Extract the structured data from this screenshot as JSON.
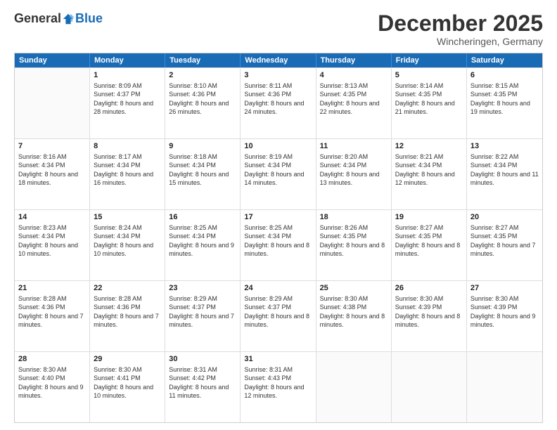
{
  "header": {
    "logo": {
      "general": "General",
      "blue": "Blue"
    },
    "title": "December 2025",
    "location": "Wincheringen, Germany"
  },
  "calendar": {
    "days_of_week": [
      "Sunday",
      "Monday",
      "Tuesday",
      "Wednesday",
      "Thursday",
      "Friday",
      "Saturday"
    ],
    "rows": [
      [
        {
          "day": "",
          "sunrise": "",
          "sunset": "",
          "daylight": ""
        },
        {
          "day": "1",
          "sunrise": "Sunrise: 8:09 AM",
          "sunset": "Sunset: 4:37 PM",
          "daylight": "Daylight: 8 hours and 28 minutes."
        },
        {
          "day": "2",
          "sunrise": "Sunrise: 8:10 AM",
          "sunset": "Sunset: 4:36 PM",
          "daylight": "Daylight: 8 hours and 26 minutes."
        },
        {
          "day": "3",
          "sunrise": "Sunrise: 8:11 AM",
          "sunset": "Sunset: 4:36 PM",
          "daylight": "Daylight: 8 hours and 24 minutes."
        },
        {
          "day": "4",
          "sunrise": "Sunrise: 8:13 AM",
          "sunset": "Sunset: 4:35 PM",
          "daylight": "Daylight: 8 hours and 22 minutes."
        },
        {
          "day": "5",
          "sunrise": "Sunrise: 8:14 AM",
          "sunset": "Sunset: 4:35 PM",
          "daylight": "Daylight: 8 hours and 21 minutes."
        },
        {
          "day": "6",
          "sunrise": "Sunrise: 8:15 AM",
          "sunset": "Sunset: 4:35 PM",
          "daylight": "Daylight: 8 hours and 19 minutes."
        }
      ],
      [
        {
          "day": "7",
          "sunrise": "Sunrise: 8:16 AM",
          "sunset": "Sunset: 4:34 PM",
          "daylight": "Daylight: 8 hours and 18 minutes."
        },
        {
          "day": "8",
          "sunrise": "Sunrise: 8:17 AM",
          "sunset": "Sunset: 4:34 PM",
          "daylight": "Daylight: 8 hours and 16 minutes."
        },
        {
          "day": "9",
          "sunrise": "Sunrise: 8:18 AM",
          "sunset": "Sunset: 4:34 PM",
          "daylight": "Daylight: 8 hours and 15 minutes."
        },
        {
          "day": "10",
          "sunrise": "Sunrise: 8:19 AM",
          "sunset": "Sunset: 4:34 PM",
          "daylight": "Daylight: 8 hours and 14 minutes."
        },
        {
          "day": "11",
          "sunrise": "Sunrise: 8:20 AM",
          "sunset": "Sunset: 4:34 PM",
          "daylight": "Daylight: 8 hours and 13 minutes."
        },
        {
          "day": "12",
          "sunrise": "Sunrise: 8:21 AM",
          "sunset": "Sunset: 4:34 PM",
          "daylight": "Daylight: 8 hours and 12 minutes."
        },
        {
          "day": "13",
          "sunrise": "Sunrise: 8:22 AM",
          "sunset": "Sunset: 4:34 PM",
          "daylight": "Daylight: 8 hours and 11 minutes."
        }
      ],
      [
        {
          "day": "14",
          "sunrise": "Sunrise: 8:23 AM",
          "sunset": "Sunset: 4:34 PM",
          "daylight": "Daylight: 8 hours and 10 minutes."
        },
        {
          "day": "15",
          "sunrise": "Sunrise: 8:24 AM",
          "sunset": "Sunset: 4:34 PM",
          "daylight": "Daylight: 8 hours and 10 minutes."
        },
        {
          "day": "16",
          "sunrise": "Sunrise: 8:25 AM",
          "sunset": "Sunset: 4:34 PM",
          "daylight": "Daylight: 8 hours and 9 minutes."
        },
        {
          "day": "17",
          "sunrise": "Sunrise: 8:25 AM",
          "sunset": "Sunset: 4:34 PM",
          "daylight": "Daylight: 8 hours and 8 minutes."
        },
        {
          "day": "18",
          "sunrise": "Sunrise: 8:26 AM",
          "sunset": "Sunset: 4:35 PM",
          "daylight": "Daylight: 8 hours and 8 minutes."
        },
        {
          "day": "19",
          "sunrise": "Sunrise: 8:27 AM",
          "sunset": "Sunset: 4:35 PM",
          "daylight": "Daylight: 8 hours and 8 minutes."
        },
        {
          "day": "20",
          "sunrise": "Sunrise: 8:27 AM",
          "sunset": "Sunset: 4:35 PM",
          "daylight": "Daylight: 8 hours and 7 minutes."
        }
      ],
      [
        {
          "day": "21",
          "sunrise": "Sunrise: 8:28 AM",
          "sunset": "Sunset: 4:36 PM",
          "daylight": "Daylight: 8 hours and 7 minutes."
        },
        {
          "day": "22",
          "sunrise": "Sunrise: 8:28 AM",
          "sunset": "Sunset: 4:36 PM",
          "daylight": "Daylight: 8 hours and 7 minutes."
        },
        {
          "day": "23",
          "sunrise": "Sunrise: 8:29 AM",
          "sunset": "Sunset: 4:37 PM",
          "daylight": "Daylight: 8 hours and 7 minutes."
        },
        {
          "day": "24",
          "sunrise": "Sunrise: 8:29 AM",
          "sunset": "Sunset: 4:37 PM",
          "daylight": "Daylight: 8 hours and 8 minutes."
        },
        {
          "day": "25",
          "sunrise": "Sunrise: 8:30 AM",
          "sunset": "Sunset: 4:38 PM",
          "daylight": "Daylight: 8 hours and 8 minutes."
        },
        {
          "day": "26",
          "sunrise": "Sunrise: 8:30 AM",
          "sunset": "Sunset: 4:39 PM",
          "daylight": "Daylight: 8 hours and 8 minutes."
        },
        {
          "day": "27",
          "sunrise": "Sunrise: 8:30 AM",
          "sunset": "Sunset: 4:39 PM",
          "daylight": "Daylight: 8 hours and 9 minutes."
        }
      ],
      [
        {
          "day": "28",
          "sunrise": "Sunrise: 8:30 AM",
          "sunset": "Sunset: 4:40 PM",
          "daylight": "Daylight: 8 hours and 9 minutes."
        },
        {
          "day": "29",
          "sunrise": "Sunrise: 8:30 AM",
          "sunset": "Sunset: 4:41 PM",
          "daylight": "Daylight: 8 hours and 10 minutes."
        },
        {
          "day": "30",
          "sunrise": "Sunrise: 8:31 AM",
          "sunset": "Sunset: 4:42 PM",
          "daylight": "Daylight: 8 hours and 11 minutes."
        },
        {
          "day": "31",
          "sunrise": "Sunrise: 8:31 AM",
          "sunset": "Sunset: 4:43 PM",
          "daylight": "Daylight: 8 hours and 12 minutes."
        },
        {
          "day": "",
          "sunrise": "",
          "sunset": "",
          "daylight": ""
        },
        {
          "day": "",
          "sunrise": "",
          "sunset": "",
          "daylight": ""
        },
        {
          "day": "",
          "sunrise": "",
          "sunset": "",
          "daylight": ""
        }
      ]
    ]
  }
}
